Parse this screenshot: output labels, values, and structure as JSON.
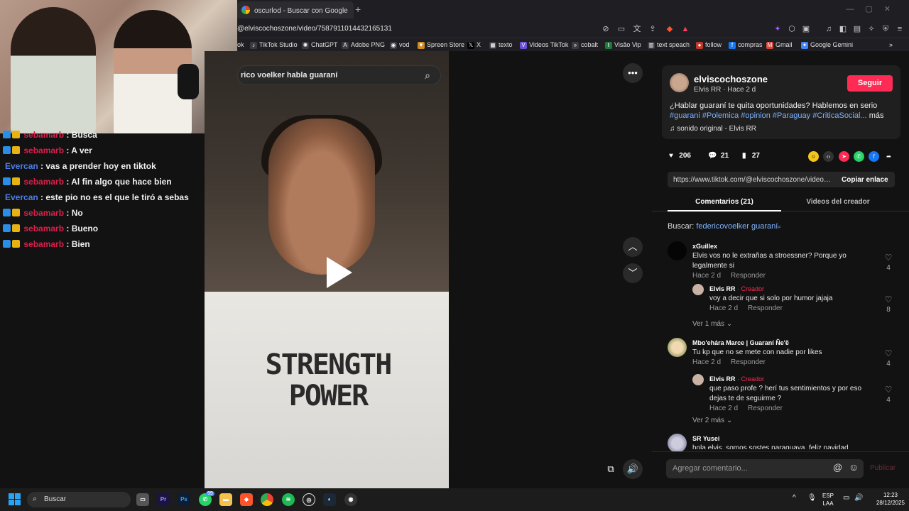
{
  "browser": {
    "tab_title": "oscurlod - Buscar con Google",
    "new_tab": "+",
    "url": "@elviscochoszone/video/7587911014432165131",
    "bookmarks": [
      {
        "label": "ok"
      },
      {
        "label": "TikTok Studio"
      },
      {
        "label": "ChatGPT"
      },
      {
        "label": "Adobe PNG"
      },
      {
        "label": "vod"
      },
      {
        "label": "Spreen Store"
      },
      {
        "label": "X"
      },
      {
        "label": "texto"
      },
      {
        "label": "Videos TikTok"
      },
      {
        "label": "cobalt"
      },
      {
        "label": "Visão Vip"
      },
      {
        "label": "text speach"
      },
      {
        "label": "follow"
      },
      {
        "label": "compras"
      },
      {
        "label": "Gmail"
      },
      {
        "label": "Google Gemini"
      }
    ]
  },
  "chat": {
    "messages": [
      {
        "user": "sebamarb",
        "text": "Busca",
        "color": "red"
      },
      {
        "user": "sebamarb",
        "text": "A ver",
        "color": "red"
      },
      {
        "user": "Evercan",
        "text": "vas a prender hoy en tiktok",
        "color": "blue"
      },
      {
        "user": "sebamarb",
        "text": "Al fin algo que hace bien",
        "color": "red"
      },
      {
        "user": "Evercan",
        "text": "este pio no es el que le tiró a sebas",
        "color": "blue"
      },
      {
        "user": "sebamarb",
        "text": "No",
        "color": "red"
      },
      {
        "user": "sebamarb",
        "text": "Bueno",
        "color": "red"
      },
      {
        "user": "sebamarb",
        "text": "Bien",
        "color": "red"
      }
    ]
  },
  "video": {
    "search_text": "rico voelker habla guaraní",
    "shirt_text": "STRENGTH POWER"
  },
  "post": {
    "username": "elviscochoszone",
    "subinfo": "Elvis RR · Hace 2 d",
    "follow_label": "Seguir",
    "description": "¿Hablar guaraní te quita oportunidades? Hablemos en serio",
    "hashtags": "#guarani #Polemica #opinion #Paraguay #CriticaSocial...",
    "more_label": "más",
    "sound": "sonido original - Elvis RR",
    "likes": "206",
    "comments_count": "21",
    "saves": "27",
    "link": "https://www.tiktok.com/@elviscochoszone/video/...",
    "copy_label": "Copiar enlace",
    "tab_comments": "Comentarios (21)",
    "tab_creator": "Videos del creador",
    "search_prefix": "Buscar:",
    "search_term": "federicovoelker guaraní",
    "comment_placeholder": "Agregar comentario...",
    "publish_label": "Publicar"
  },
  "comments": [
    {
      "name": "xGuillex",
      "text": "Elvis vos no le extrañas a stroessner? Porque yo legalmente si",
      "meta": "Hace 2 d",
      "reply": "Responder",
      "likes": "4"
    },
    {
      "name": "Elvis RR",
      "creator": "· Creador",
      "text": "voy a decir que si solo por humor jajaja",
      "meta": "Hace 2 d",
      "reply": "Responder",
      "likes": "8"
    },
    {
      "more": "Ver 1 más"
    },
    {
      "name": "Mbo'ehára Marce | Guaraní Ñe'ẽ",
      "text": "Tu kp que no se mete con nadie por likes",
      "meta": "Hace 2 d",
      "reply": "Responder",
      "likes": "4"
    },
    {
      "name": "Elvis RR",
      "creator": "· Creador",
      "text": "que paso profe ? herí tus sentimientos y por eso dejas te de seguirme ?",
      "meta": "Hace 2 d",
      "reply": "Responder",
      "likes": "4"
    },
    {
      "more": "Ver 2 más"
    },
    {
      "name": "SR Yusei",
      "text": "hola elvis, somos sostes paraguaya, feliz navidad"
    }
  ],
  "taskbar": {
    "search_label": "Buscar",
    "lang1": "ESP",
    "lang2": "LAA",
    "time": "12:23",
    "date": "28/12/2025",
    "whatsapp_badge": "99"
  }
}
